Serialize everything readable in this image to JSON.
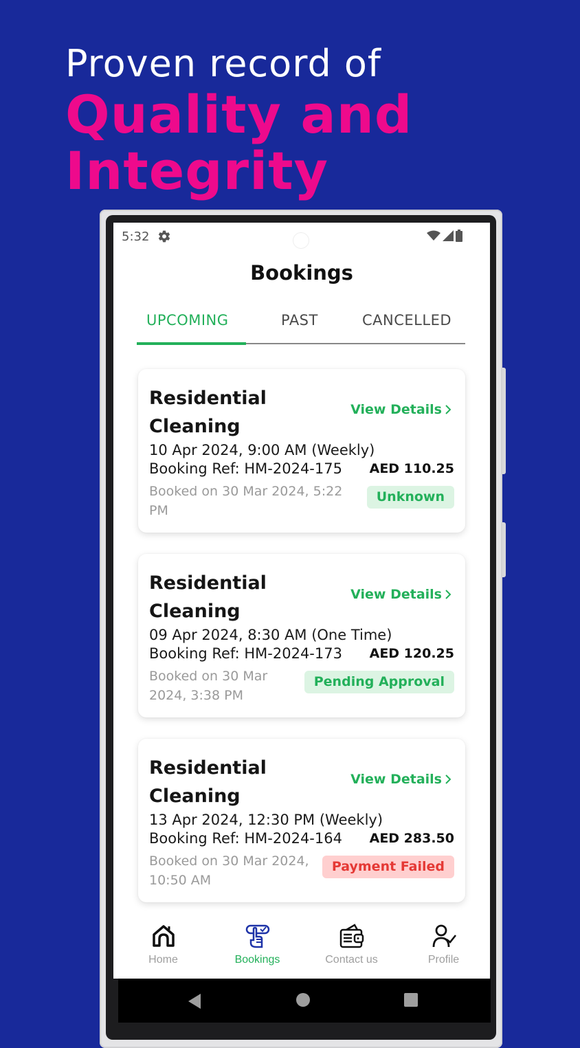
{
  "promo": {
    "line1": "Proven record of",
    "line2": "Quality and",
    "line3": "Integrity",
    "colors": {
      "background": "#18299a",
      "accent": "#ee0a8c",
      "text": "#ffffff"
    }
  },
  "status_bar": {
    "time": "5:32",
    "icons": [
      "gear-icon",
      "wifi-icon",
      "signal-icon",
      "battery-icon"
    ]
  },
  "app": {
    "title": "Bookings",
    "accent_color": "#23b05a"
  },
  "tabs": [
    {
      "label": "UPCOMING",
      "active": true
    },
    {
      "label": "PAST",
      "active": false
    },
    {
      "label": "CANCELLED",
      "active": false
    }
  ],
  "bookings": [
    {
      "title": "Residential Cleaning",
      "view_details": "View Details",
      "datetime": "10 Apr 2024, 9:00 AM (Weekly)",
      "ref": "Booking Ref: HM-2024-175",
      "amount": "AED 110.25",
      "booked_on": "Booked on 30 Mar 2024, 5:22 PM",
      "status": "Unknown",
      "status_color": "green"
    },
    {
      "title": "Residential Cleaning",
      "view_details": "View Details",
      "datetime": "09 Apr 2024, 8:30 AM (One Time)",
      "ref": "Booking Ref: HM-2024-173",
      "amount": "AED 120.25",
      "booked_on": "Booked on 30 Mar 2024, 3:38 PM",
      "status": "Pending Approval",
      "status_color": "green"
    },
    {
      "title": "Residential Cleaning",
      "view_details": "View Details",
      "datetime": "13 Apr 2024, 12:30 PM (Weekly)",
      "ref": "Booking Ref: HM-2024-164",
      "amount": "AED 283.50",
      "booked_on": "Booked on 30 Mar 2024, 10:50 AM",
      "status": "Payment Failed",
      "status_color": "red"
    }
  ],
  "bottom_nav": [
    {
      "label": "Home",
      "icon": "home-icon",
      "active": false
    },
    {
      "label": "Bookings",
      "icon": "bookings-icon",
      "active": true
    },
    {
      "label": "Contact us",
      "icon": "wallet-icon",
      "active": false
    },
    {
      "label": "Profile",
      "icon": "profile-icon",
      "active": false
    }
  ],
  "system_nav": [
    "back-icon",
    "home-circle-icon",
    "recents-icon"
  ]
}
